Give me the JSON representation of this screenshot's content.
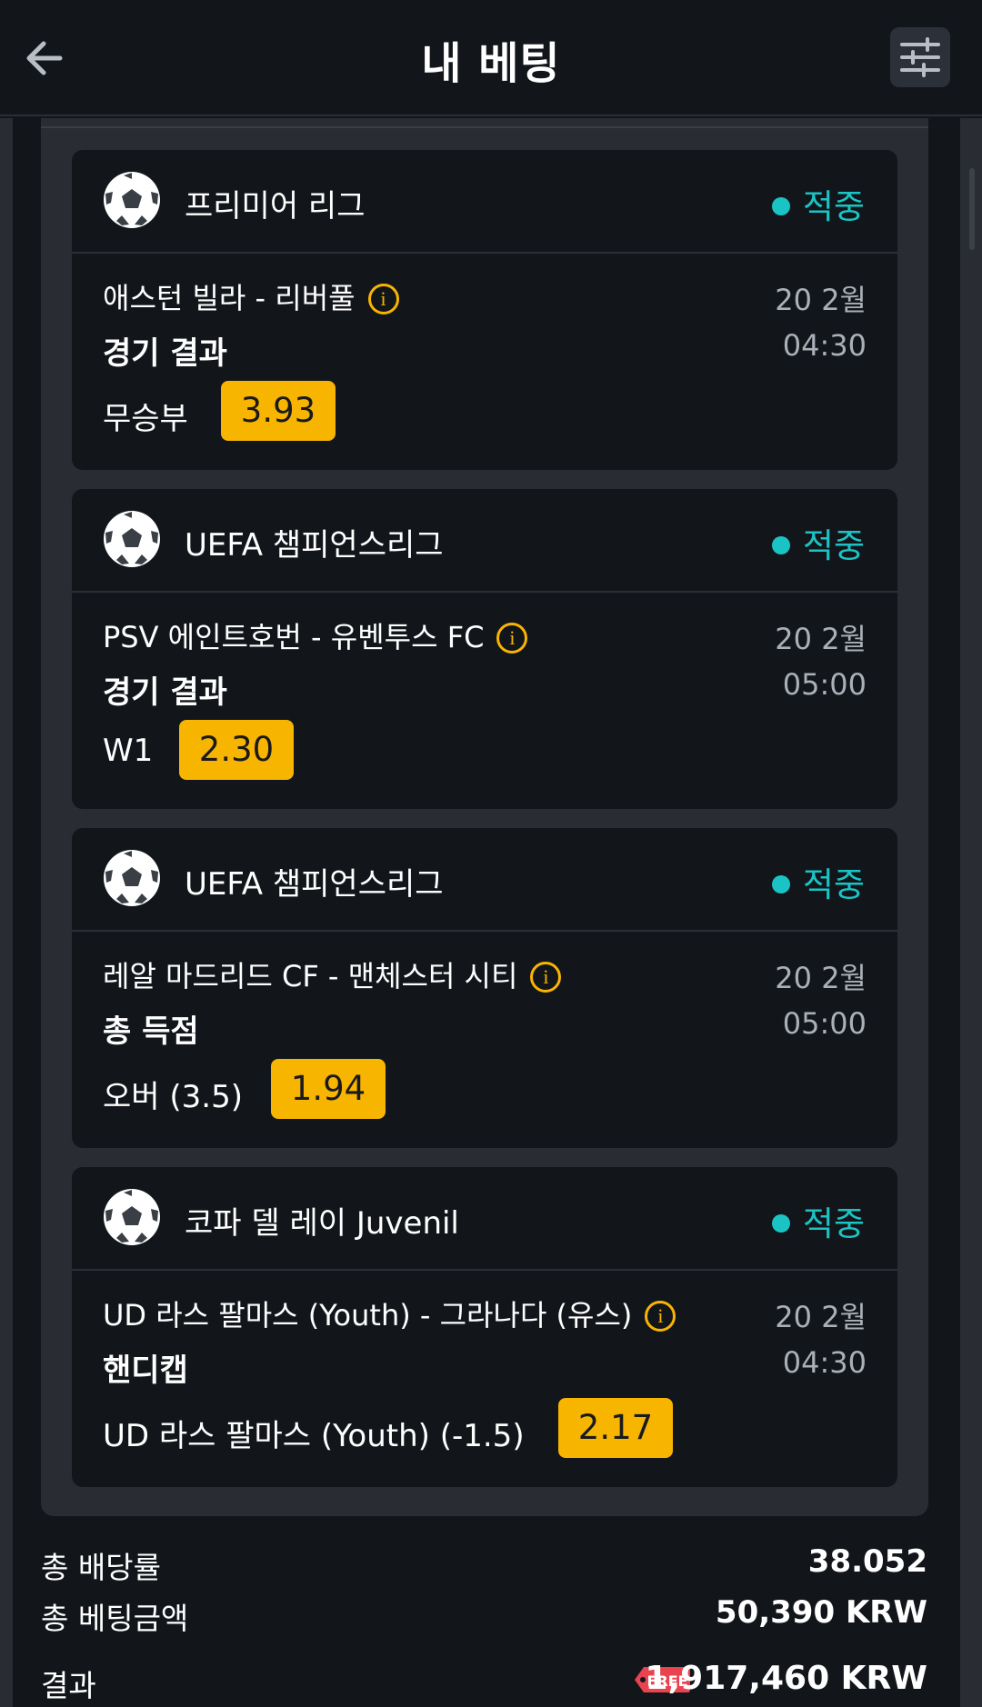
{
  "header": {
    "title": "내 베팅"
  },
  "bets": [
    {
      "league": "프리미어 리그",
      "status": "적중",
      "match": "애스턴 빌라 - 리버풀",
      "date": "20 2월",
      "time": "04:30",
      "market": "경기 결과",
      "selection": "무승부",
      "odds": "3.93"
    },
    {
      "league": "UEFA 챔피언스리그",
      "status": "적중",
      "match": "PSV 에인트호번 - 유벤투스 FC",
      "date": "20 2월",
      "time": "05:00",
      "market": "경기 결과",
      "selection": "W1",
      "odds": "2.30"
    },
    {
      "league": "UEFA 챔피언스리그",
      "status": "적중",
      "match": "레알 마드리드 CF - 맨체스터 시티",
      "date": "20 2월",
      "time": "05:00",
      "market": "총 득점",
      "selection": "오버 (3.5)",
      "odds": "1.94"
    },
    {
      "league": "코파 델 레이 Juvenil",
      "status": "적중",
      "match": "UD 라스 팔마스 (Youth) - 그라나다 (유스)",
      "date": "20 2월",
      "time": "04:30",
      "market": "핸디캡",
      "selection": "UD 라스 팔마스 (Youth) (-1.5)",
      "odds": "2.17"
    }
  ],
  "summary": {
    "total_odds_label": "총 배당률",
    "total_odds_value": "38.052",
    "total_stake_label": "총 베팅금액",
    "total_stake_value": "50,390 KRW",
    "result_label": "결과",
    "free_tag": "FREE",
    "result_value": "1,917,460 KRW"
  },
  "colors": {
    "accent_odds": "#f7b500",
    "status_win": "#1bc4c4",
    "background": "#12161b",
    "panel": "#292d33"
  }
}
